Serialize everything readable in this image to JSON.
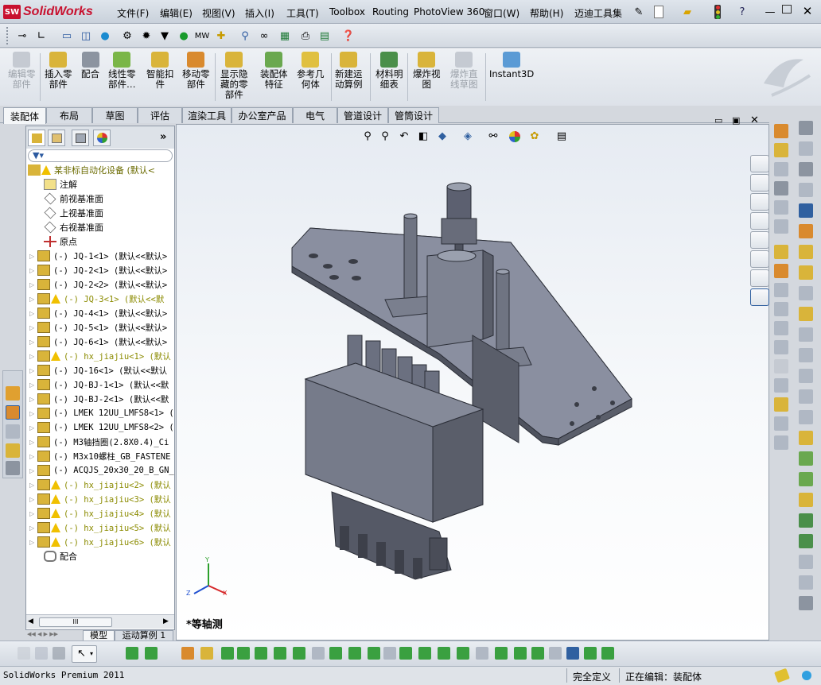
{
  "app": {
    "logo_text": "SolidWorks",
    "logo_badge": "SW"
  },
  "menu": [
    "文件(F)",
    "编辑(E)",
    "视图(V)",
    "插入(I)",
    "工具(T)",
    "Toolbox",
    "Routing",
    "PhotoView 360",
    "窗口(W)",
    "帮助(H)",
    "迈迪工具集"
  ],
  "command_manager": [
    {
      "label": "编辑零\n部件",
      "disabled": true
    },
    {
      "label": "插入零\n部件",
      "disabled": false
    },
    {
      "label": "配合",
      "disabled": false
    },
    {
      "label": "线性零\n部件…",
      "disabled": false
    },
    {
      "label": "智能扣\n件",
      "disabled": false
    },
    {
      "label": "移动零\n部件",
      "disabled": false
    },
    {
      "label": "显示隐\n藏的零\n部件",
      "disabled": false
    },
    {
      "label": "装配体\n特征",
      "disabled": false
    },
    {
      "label": "参考几\n何体",
      "disabled": false
    },
    {
      "label": "新建运\n动算例",
      "disabled": false
    },
    {
      "label": "材料明\n细表",
      "disabled": false
    },
    {
      "label": "爆炸视\n图",
      "disabled": false
    },
    {
      "label": "爆炸直\n线草图",
      "disabled": true
    },
    {
      "label": "Instant3D",
      "disabled": false
    }
  ],
  "tabs": [
    "装配体",
    "布局",
    "草图",
    "评估",
    "渲染工具",
    "办公室产品",
    "电气",
    "管道设计",
    "管筒设计"
  ],
  "active_tab": "装配体",
  "tree": {
    "root": "某非标自动化设备  (默认<",
    "items": [
      {
        "type": "annotation",
        "label": "注解"
      },
      {
        "type": "plane",
        "label": "前视基准面"
      },
      {
        "type": "plane",
        "label": "上视基准面"
      },
      {
        "type": "plane",
        "label": "右视基准面"
      },
      {
        "type": "origin",
        "label": "原点"
      },
      {
        "type": "part",
        "warn": false,
        "label": "(-) JQ-1<1> (默认<<默认>"
      },
      {
        "type": "part",
        "warn": false,
        "label": "(-) JQ-2<1> (默认<<默认>"
      },
      {
        "type": "part",
        "warn": false,
        "label": "(-) JQ-2<2> (默认<<默认>"
      },
      {
        "type": "part",
        "warn": true,
        "label": "(-) JQ-3<1> (默认<<默"
      },
      {
        "type": "part",
        "warn": false,
        "label": "(-) JQ-4<1> (默认<<默认>"
      },
      {
        "type": "part",
        "warn": false,
        "label": "(-) JQ-5<1> (默认<<默认>"
      },
      {
        "type": "part",
        "warn": false,
        "label": "(-) JQ-6<1> (默认<<默认>"
      },
      {
        "type": "part",
        "warn": true,
        "label": "(-) hx_jiajiu<1> (默认"
      },
      {
        "type": "part",
        "warn": false,
        "label": "(-) JQ-16<1> (默认<<默认"
      },
      {
        "type": "part",
        "warn": false,
        "label": "(-) JQ-BJ-1<1> (默认<<默"
      },
      {
        "type": "part",
        "warn": false,
        "label": "(-) JQ-BJ-2<1> (默认<<默"
      },
      {
        "type": "part",
        "warn": false,
        "label": "(-) LMEK 12UU_LMFS8<1> ("
      },
      {
        "type": "part",
        "warn": false,
        "label": "(-) LMEK 12UU_LMFS8<2> ("
      },
      {
        "type": "part",
        "warn": false,
        "label": "(-) M3轴挡圈(2.8X0.4)_Ci"
      },
      {
        "type": "part",
        "warn": false,
        "label": "(-) M3x10螺柱_GB_FASTENE"
      },
      {
        "type": "part",
        "warn": false,
        "label": "(-) ACQJS_20x30_20_B_GN_"
      },
      {
        "type": "part",
        "warn": true,
        "label": "(-) hx_jiajiu<2> (默认"
      },
      {
        "type": "part",
        "warn": true,
        "label": "(-) hx_jiajiu<3> (默认"
      },
      {
        "type": "part",
        "warn": true,
        "label": "(-) hx_jiajiu<4> (默认"
      },
      {
        "type": "part",
        "warn": true,
        "label": "(-) hx_jiajiu<5> (默认"
      },
      {
        "type": "part",
        "warn": true,
        "label": "(-) hx_jiajiu<6> (默认"
      },
      {
        "type": "mates",
        "label": "配合"
      }
    ],
    "scroll_thumb": "III"
  },
  "bottom_tabs": [
    "模型",
    "运动算例 1"
  ],
  "viewport": {
    "view_label": "*等轴测",
    "triad": {
      "x": "X",
      "y": "Y",
      "z": "Z"
    }
  },
  "status": {
    "product": "SolidWorks Premium 2011",
    "definition": "完全定义",
    "editing": "正在编辑：装配体"
  },
  "colors": {
    "accent": "#c8102e",
    "model": "#6b7080",
    "viewport_top": "#e6ebf2"
  },
  "window_controls": [
    "minimize-icon",
    "restore-icon",
    "close-icon"
  ]
}
